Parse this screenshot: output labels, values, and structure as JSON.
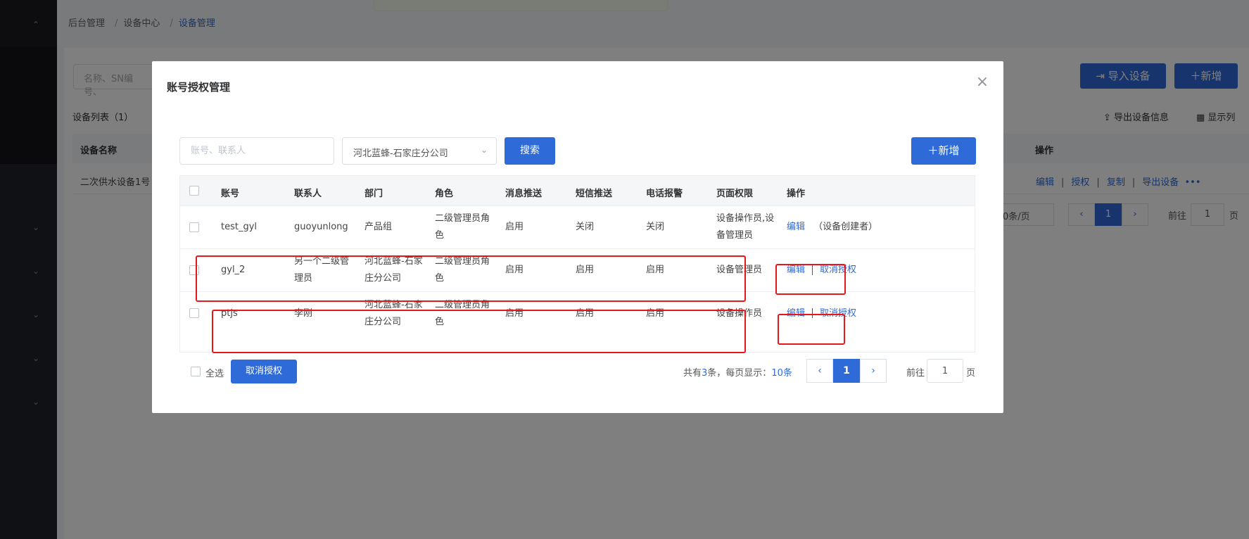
{
  "breadcrumb": {
    "item1": "后台管理",
    "item2": "设备中心",
    "item3": "设备管理",
    "sep": "/"
  },
  "background": {
    "search_placeholder": "名称、SN编号、",
    "import_btn": "导入设备",
    "add_btn": "新增",
    "list_title": "设备列表（1）",
    "export_info": "导出设备信息",
    "display_cols": "显示列",
    "col_name": "设备名称",
    "col_ops": "操作",
    "row_name": "二次供水设备1号",
    "row_acts": {
      "edit": "编辑",
      "auth": "授权",
      "copy": "复制",
      "export": "导出设备",
      "more": "•••"
    },
    "page_size": "0条/页",
    "page_current": "1",
    "goto_label": "前往",
    "goto_value": "1",
    "page_suffix": "页"
  },
  "modal": {
    "title": "账号授权管理",
    "close_icon": "×",
    "search_placeholder": "账号、联系人",
    "dept_select": "河北蓝蜂-石家庄分公司",
    "search_btn": "搜索",
    "add_btn": "新增",
    "headers": [
      "账号",
      "联系人",
      "部门",
      "角色",
      "消息推送",
      "短信推送",
      "电话报警",
      "页面权限",
      "操作"
    ],
    "rows": [
      {
        "account": "test_gyl",
        "contact": "guoyunlong",
        "dept": "产品组",
        "role": "二级管理员角色",
        "msg": "启用",
        "sms": "关闭",
        "phone": "关闭",
        "perm": "设备操作员,设备管理员",
        "edit": "编辑",
        "extra": "（设备创建者）"
      },
      {
        "account": "gyl_2",
        "contact": "另一个二级管理员",
        "dept": "河北蓝蜂-石家庄分公司",
        "role": "二级管理员角色",
        "msg": "启用",
        "sms": "启用",
        "phone": "启用",
        "perm": "设备管理员",
        "edit": "编辑",
        "revoke": "取消授权"
      },
      {
        "account": "ptjs",
        "contact": "李刚",
        "dept": "河北蓝蜂-石家庄分公司",
        "role": "二级管理员角色",
        "msg": "启用",
        "sms": "启用",
        "phone": "启用",
        "perm": "设备操作员",
        "edit": "编辑",
        "revoke": "取消授权"
      }
    ],
    "select_all": "全选",
    "cancel_auth_btn": "取消授权",
    "pager": {
      "total_prefix": "共有",
      "total": "3",
      "total_mid": "条，每页显示：",
      "page_size": "10条",
      "prev": "‹",
      "current": "1",
      "next": "›",
      "goto_label": "前往",
      "goto_value": "1",
      "goto_suffix": "页"
    }
  },
  "colors": {
    "primary": "#2f6bd8",
    "highlight": "#e8151b"
  }
}
